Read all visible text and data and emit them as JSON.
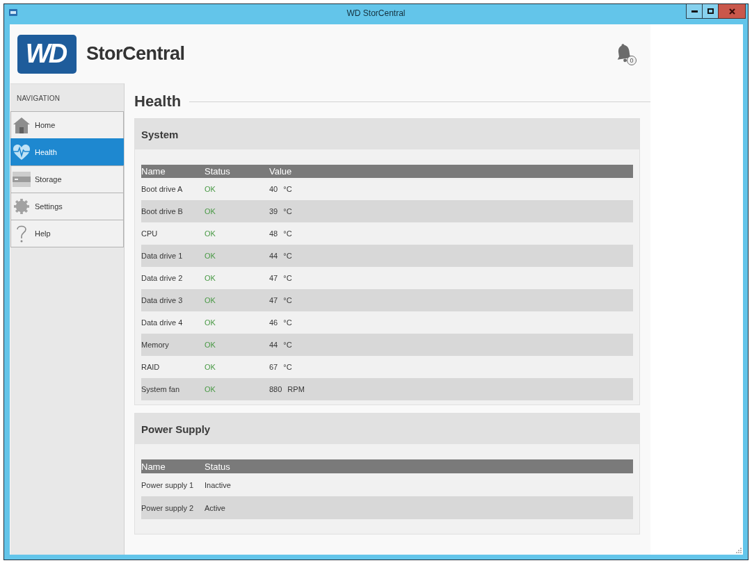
{
  "window": {
    "title": "WD StorCentral"
  },
  "header": {
    "logo_mark": "WD",
    "product_name": "StorCentral",
    "notification_count": "0"
  },
  "navigation": {
    "heading": "NAVIGATION",
    "items": [
      {
        "label": "Home",
        "kind": "home",
        "selected": false
      },
      {
        "label": "Health",
        "kind": "health",
        "selected": true
      },
      {
        "label": "Storage",
        "kind": "storage",
        "selected": false
      },
      {
        "label": "Settings",
        "kind": "settings",
        "selected": false
      },
      {
        "label": "Help",
        "kind": "help",
        "selected": false
      }
    ]
  },
  "page": {
    "title": "Health"
  },
  "panels": [
    {
      "kind": "sensors",
      "title": "System",
      "columns": [
        "Name",
        "Status",
        "Value"
      ],
      "rows": [
        {
          "name": "Boot drive A",
          "status": "OK",
          "value": "40",
          "unit": "°C"
        },
        {
          "name": "Boot drive B",
          "status": "OK",
          "value": "39",
          "unit": "°C"
        },
        {
          "name": "CPU",
          "status": "OK",
          "value": "48",
          "unit": "°C"
        },
        {
          "name": "Data drive 1",
          "status": "OK",
          "value": "44",
          "unit": "°C"
        },
        {
          "name": "Data drive 2",
          "status": "OK",
          "value": "47",
          "unit": "°C"
        },
        {
          "name": "Data drive 3",
          "status": "OK",
          "value": "47",
          "unit": "°C"
        },
        {
          "name": "Data drive 4",
          "status": "OK",
          "value": "46",
          "unit": "°C"
        },
        {
          "name": "Memory",
          "status": "OK",
          "value": "44",
          "unit": "°C"
        },
        {
          "name": "RAID",
          "status": "OK",
          "value": "67",
          "unit": "°C"
        },
        {
          "name": "System fan",
          "status": "OK",
          "value": "880",
          "unit": "RPM"
        }
      ]
    },
    {
      "kind": "power",
      "title": "Power Supply",
      "columns": [
        "Name",
        "Status"
      ],
      "rows": [
        {
          "name": "Power supply 1",
          "status": "Inactive"
        },
        {
          "name": "Power supply 2",
          "status": "Active"
        }
      ]
    }
  ]
}
